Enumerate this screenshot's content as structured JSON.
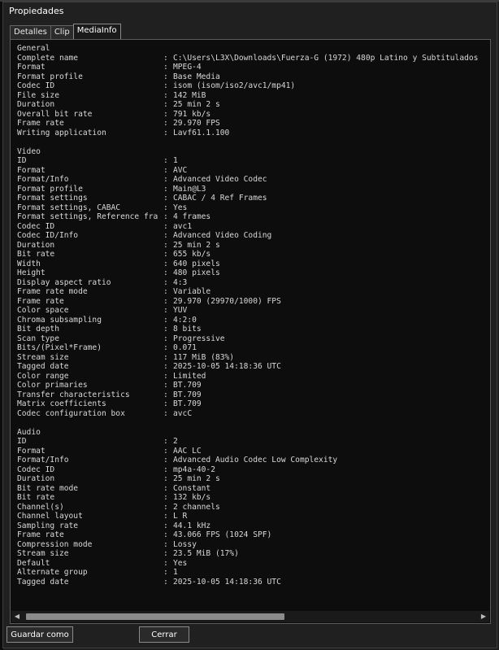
{
  "window": {
    "title": "Propiedades"
  },
  "tabs": [
    {
      "label": "Detalles",
      "active": false
    },
    {
      "label": "Clip",
      "active": false
    },
    {
      "label": "MediaInfo",
      "active": true
    }
  ],
  "mediainfo": {
    "separator": ":",
    "sections": [
      {
        "header": "General",
        "rows": [
          {
            "label": "Complete name",
            "value": "C:\\Users\\L3X\\Downloads\\Fuerza-G (1972) 480p Latino y Subtitulados"
          },
          {
            "label": "Format",
            "value": "MPEG-4"
          },
          {
            "label": "Format profile",
            "value": "Base Media"
          },
          {
            "label": "Codec ID",
            "value": "isom (isom/iso2/avc1/mp41)"
          },
          {
            "label": "File size",
            "value": "142 MiB"
          },
          {
            "label": "Duration",
            "value": "25 min 2 s"
          },
          {
            "label": "Overall bit rate",
            "value": "791 kb/s"
          },
          {
            "label": "Frame rate",
            "value": "29.970 FPS"
          },
          {
            "label": "Writing application",
            "value": "Lavf61.1.100"
          }
        ]
      },
      {
        "header": "Video",
        "rows": [
          {
            "label": "ID",
            "value": "1"
          },
          {
            "label": "Format",
            "value": "AVC"
          },
          {
            "label": "Format/Info",
            "value": "Advanced Video Codec"
          },
          {
            "label": "Format profile",
            "value": "Main@L3"
          },
          {
            "label": "Format settings",
            "value": "CABAC / 4 Ref Frames"
          },
          {
            "label": "Format settings, CABAC",
            "value": "Yes"
          },
          {
            "label": "Format settings, Reference fra",
            "value": "4 frames"
          },
          {
            "label": "Codec ID",
            "value": "avc1"
          },
          {
            "label": "Codec ID/Info",
            "value": "Advanced Video Coding"
          },
          {
            "label": "Duration",
            "value": "25 min 2 s"
          },
          {
            "label": "Bit rate",
            "value": "655 kb/s"
          },
          {
            "label": "Width",
            "value": "640 pixels"
          },
          {
            "label": "Height",
            "value": "480 pixels"
          },
          {
            "label": "Display aspect ratio",
            "value": "4:3"
          },
          {
            "label": "Frame rate mode",
            "value": "Variable"
          },
          {
            "label": "Frame rate",
            "value": "29.970 (29970/1000) FPS"
          },
          {
            "label": "Color space",
            "value": "YUV"
          },
          {
            "label": "Chroma subsampling",
            "value": "4:2:0"
          },
          {
            "label": "Bit depth",
            "value": "8 bits"
          },
          {
            "label": "Scan type",
            "value": "Progressive"
          },
          {
            "label": "Bits/(Pixel*Frame)",
            "value": "0.071"
          },
          {
            "label": "Stream size",
            "value": "117 MiB (83%)"
          },
          {
            "label": "Tagged date",
            "value": "2025-10-05 14:18:36 UTC"
          },
          {
            "label": "Color range",
            "value": "Limited"
          },
          {
            "label": "Color primaries",
            "value": "BT.709"
          },
          {
            "label": "Transfer characteristics",
            "value": "BT.709"
          },
          {
            "label": "Matrix coefficients",
            "value": "BT.709"
          },
          {
            "label": "Codec configuration box",
            "value": "avcC"
          }
        ]
      },
      {
        "header": "Audio",
        "rows": [
          {
            "label": "ID",
            "value": "2"
          },
          {
            "label": "Format",
            "value": "AAC LC"
          },
          {
            "label": "Format/Info",
            "value": "Advanced Audio Codec Low Complexity"
          },
          {
            "label": "Codec ID",
            "value": "mp4a-40-2"
          },
          {
            "label": "Duration",
            "value": "25 min 2 s"
          },
          {
            "label": "Bit rate mode",
            "value": "Constant"
          },
          {
            "label": "Bit rate",
            "value": "132 kb/s"
          },
          {
            "label": "Channel(s)",
            "value": "2 channels"
          },
          {
            "label": "Channel layout",
            "value": "L R"
          },
          {
            "label": "Sampling rate",
            "value": "44.1 kHz"
          },
          {
            "label": "Frame rate",
            "value": "43.066 FPS (1024 SPF)"
          },
          {
            "label": "Compression mode",
            "value": "Lossy"
          },
          {
            "label": "Stream size",
            "value": "23.5 MiB (17%)"
          },
          {
            "label": "Default",
            "value": "Yes"
          },
          {
            "label": "Alternate group",
            "value": "1"
          },
          {
            "label": "Tagged date",
            "value": "2025-10-05 14:18:36 UTC"
          }
        ]
      }
    ]
  },
  "scrollbar": {
    "left_arrow": "◀",
    "right_arrow": "▶"
  },
  "buttons": {
    "save_label": "Guardar como",
    "cancel_label": "Cerrar"
  },
  "colors": {
    "panel_bg": "#0d0d0d",
    "window_bg": "#202020",
    "text": "#d8d8d8"
  }
}
